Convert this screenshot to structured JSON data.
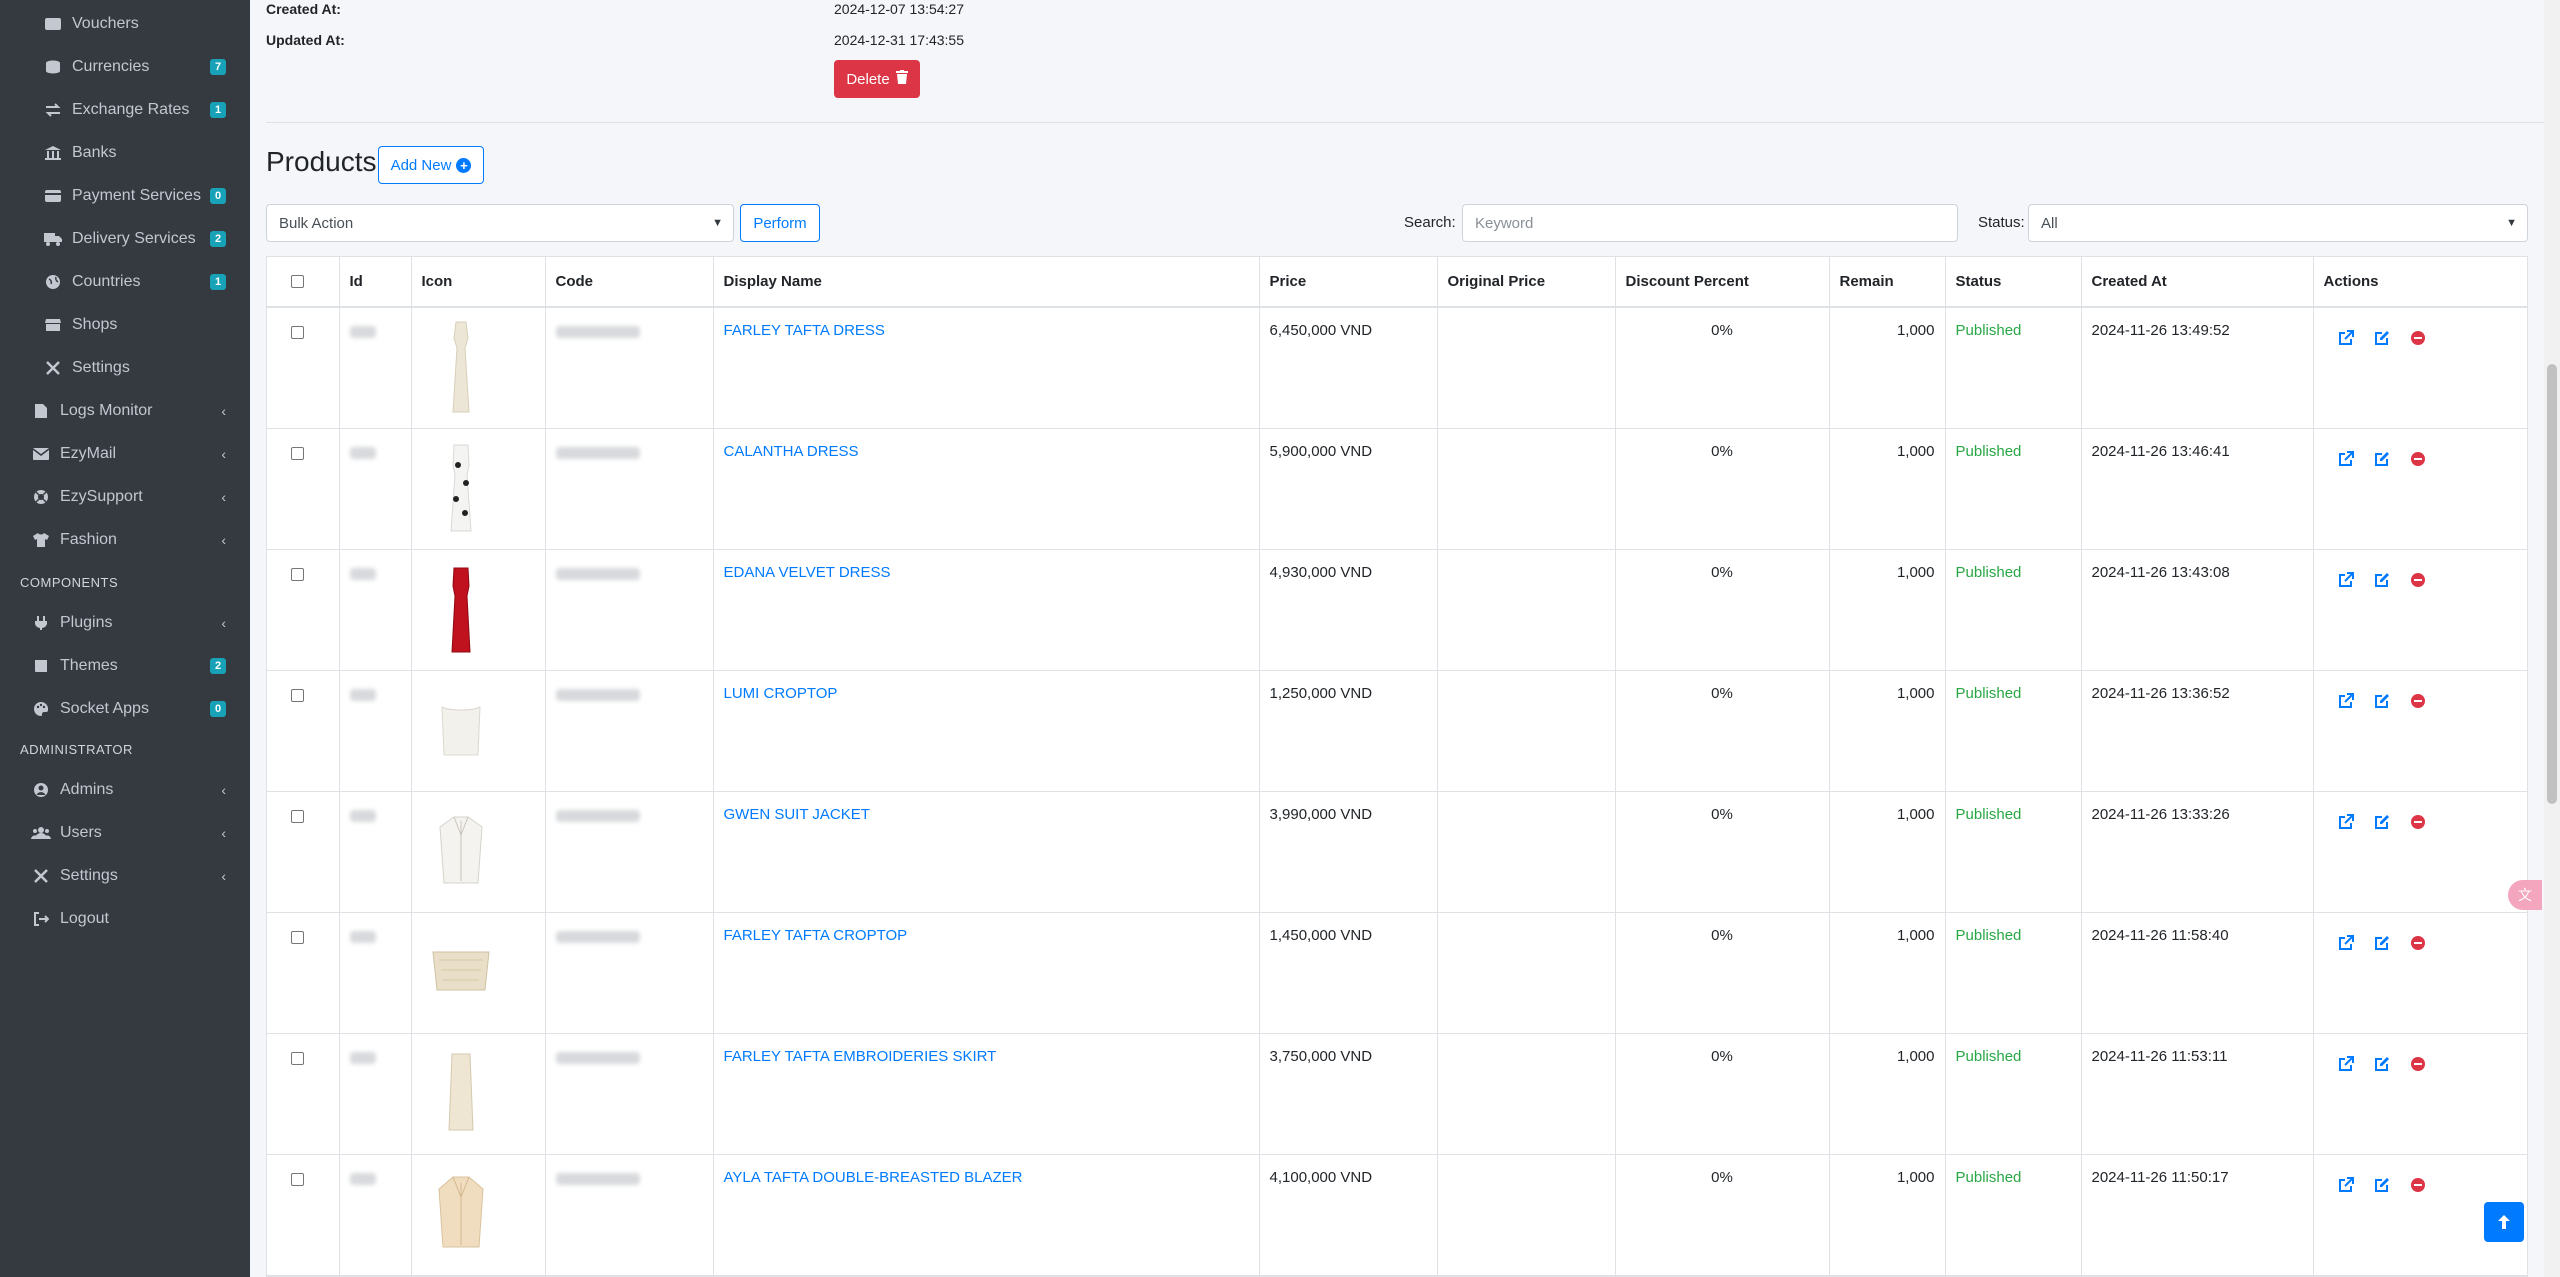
{
  "sidebar": {
    "items": [
      {
        "label": "Vouchers",
        "icon": "ticket-icon",
        "badge": "",
        "chevron": false
      },
      {
        "label": "Currencies",
        "icon": "coins-icon",
        "badge": "7",
        "chevron": false
      },
      {
        "label": "Exchange Rates",
        "icon": "exchange-icon",
        "badge": "1",
        "chevron": false
      },
      {
        "label": "Banks",
        "icon": "bank-icon",
        "badge": "",
        "chevron": false
      },
      {
        "label": "Payment Services",
        "icon": "credit-card-icon",
        "badge": "0",
        "chevron": false
      },
      {
        "label": "Delivery Services",
        "icon": "truck-icon",
        "badge": "2",
        "chevron": false
      },
      {
        "label": "Countries",
        "icon": "globe-icon",
        "badge": "1",
        "chevron": false
      },
      {
        "label": "Shops",
        "icon": "store-icon",
        "badge": "",
        "chevron": false
      },
      {
        "label": "Settings",
        "icon": "tools-icon",
        "badge": "",
        "chevron": false
      }
    ],
    "top_items": [
      {
        "label": "Logs Monitor",
        "icon": "file-icon",
        "chevron": "‹"
      },
      {
        "label": "EzyMail",
        "icon": "envelope-icon",
        "chevron": "‹"
      },
      {
        "label": "EzySupport",
        "icon": "lifebuoy-icon",
        "chevron": "‹"
      },
      {
        "label": "Fashion",
        "icon": "tshirt-icon",
        "chevron": "‹"
      }
    ],
    "components_header": "COMPONENTS",
    "components": [
      {
        "label": "Plugins",
        "icon": "plug-icon",
        "badge": "",
        "chevron": "‹"
      },
      {
        "label": "Themes",
        "icon": "book-icon",
        "badge": "2",
        "chevron": ""
      },
      {
        "label": "Socket Apps",
        "icon": "palette-icon",
        "badge": "0",
        "chevron": ""
      }
    ],
    "admin_header": "ADMINISTRATOR",
    "admin": [
      {
        "label": "Admins",
        "icon": "user-circle-icon",
        "chevron": "‹"
      },
      {
        "label": "Users",
        "icon": "users-icon",
        "chevron": "‹"
      },
      {
        "label": "Settings",
        "icon": "tools-icon",
        "chevron": "‹"
      },
      {
        "label": "Logout",
        "icon": "logout-icon",
        "chevron": ""
      }
    ]
  },
  "meta": {
    "created_label": "Created At:",
    "created_value": "2024-12-07 13:54:27",
    "updated_label": "Updated At:",
    "updated_value": "2024-12-31 17:43:55",
    "delete_label": "Delete"
  },
  "products": {
    "title": "Products",
    "add_new_label": "Add New",
    "bulk_action_value": "Bulk Action",
    "perform_label": "Perform",
    "search_label": "Search:",
    "search_placeholder": "Keyword",
    "status_label": "Status:",
    "status_value": "All",
    "columns": [
      "Id",
      "Icon",
      "Code",
      "Display Name",
      "Price",
      "Original Price",
      "Discount Percent",
      "Remain",
      "Status",
      "Created At",
      "Actions"
    ],
    "rows": [
      {
        "name": "FARLEY TAFTA DRESS",
        "price": "6,450,000 VND",
        "original": "",
        "discount": "0%",
        "remain": "1,000",
        "status": "Published",
        "created": "2024-11-26 13:49:52",
        "thumb": "dress-long-cream"
      },
      {
        "name": "CALANTHA DRESS",
        "price": "5,900,000 VND",
        "original": "",
        "discount": "0%",
        "remain": "1,000",
        "status": "Published",
        "created": "2024-11-26 13:46:41",
        "thumb": "dress-floral-white"
      },
      {
        "name": "EDANA VELVET DRESS",
        "price": "4,930,000 VND",
        "original": "",
        "discount": "0%",
        "remain": "1,000",
        "status": "Published",
        "created": "2024-11-26 13:43:08",
        "thumb": "dress-red"
      },
      {
        "name": "LUMI CROPTOP",
        "price": "1,250,000 VND",
        "original": "",
        "discount": "0%",
        "remain": "1,000",
        "status": "Published",
        "created": "2024-11-26 13:36:52",
        "thumb": "croptop-white"
      },
      {
        "name": "GWEN SUIT JACKET",
        "price": "3,990,000 VND",
        "original": "",
        "discount": "0%",
        "remain": "1,000",
        "status": "Published",
        "created": "2024-11-26 13:33:26",
        "thumb": "jacket-white"
      },
      {
        "name": "FARLEY TAFTA CROPTOP",
        "price": "1,450,000 VND",
        "original": "",
        "discount": "0%",
        "remain": "1,000",
        "status": "Published",
        "created": "2024-11-26 11:58:40",
        "thumb": "croptop-cream"
      },
      {
        "name": "FARLEY TAFTA EMBROIDERIES SKIRT",
        "price": "3,750,000 VND",
        "original": "",
        "discount": "0%",
        "remain": "1,000",
        "status": "Published",
        "created": "2024-11-26 11:53:11",
        "thumb": "skirt-cream"
      },
      {
        "name": "AYLA TAFTA DOUBLE-BREASTED BLAZER",
        "price": "4,100,000 VND",
        "original": "",
        "discount": "0%",
        "remain": "1,000",
        "status": "Published",
        "created": "2024-11-26 11:50:17",
        "thumb": "blazer-beige"
      }
    ]
  },
  "colors": {
    "sidebar_bg": "#343a40",
    "primary": "#007bff",
    "danger": "#dc3545",
    "success": "#28a745",
    "badge": "#17a2b8"
  }
}
